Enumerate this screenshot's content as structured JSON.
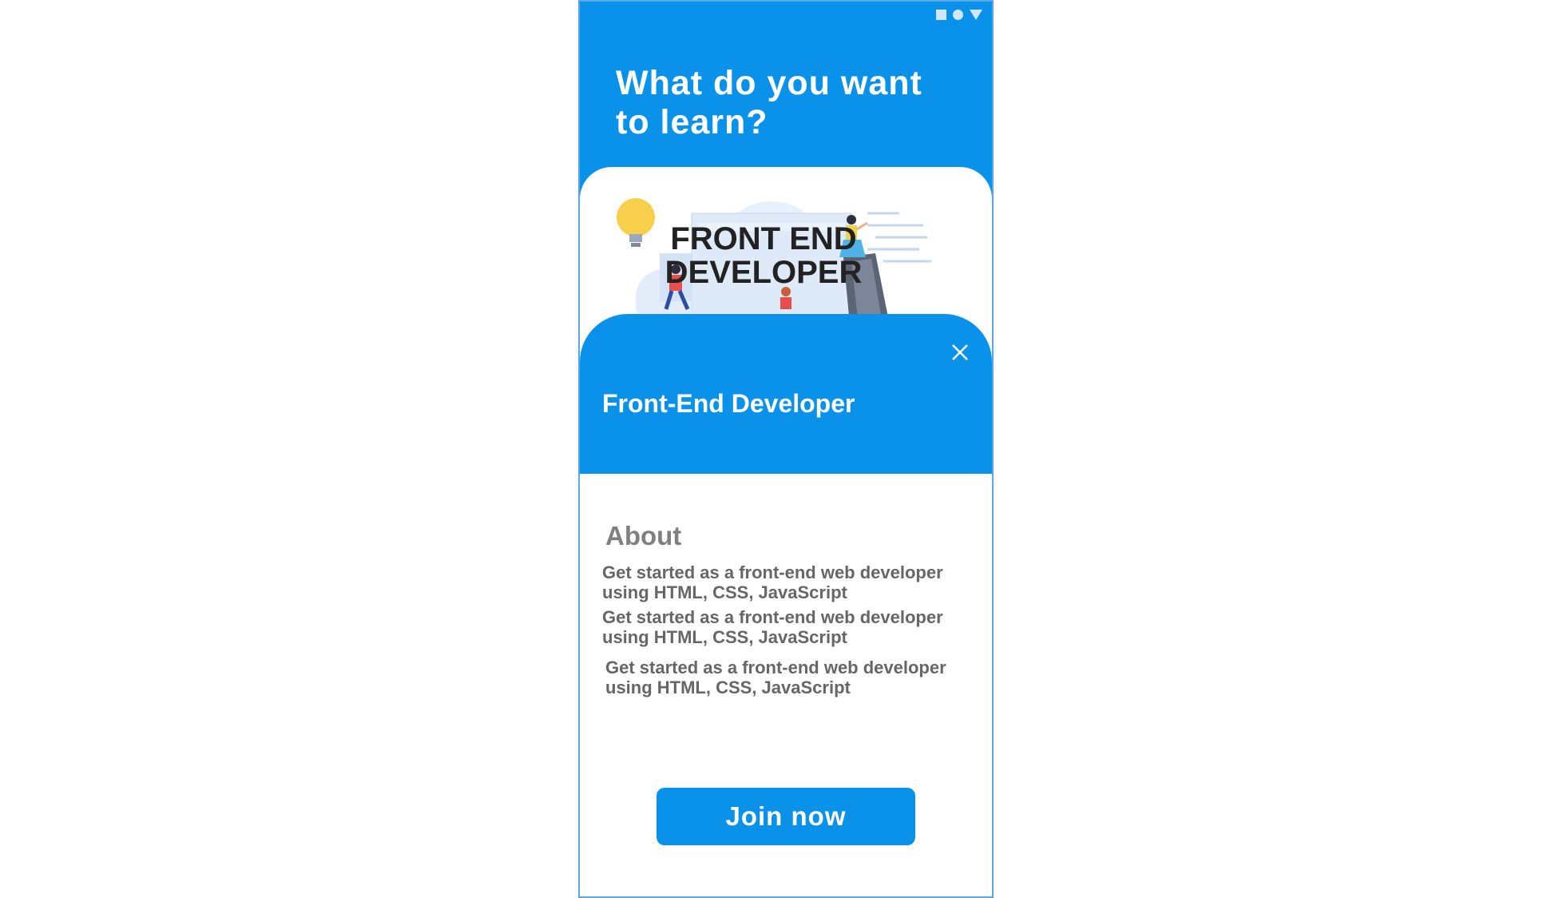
{
  "header": {
    "title_line1": "What do you want",
    "title_line2": "to learn?"
  },
  "card": {
    "illustration_line1": "FRONT END",
    "illustration_line2": "DEVELOPER"
  },
  "sheet": {
    "title": "Front-End Developer",
    "about_heading": "About",
    "descriptions": [
      "Get started as a front-end web developer using HTML, CSS, JavaScript",
      "Get started as a front-end web developer using HTML, CSS, JavaScript",
      "Get started as a front-end web developer using HTML, CSS, JavaScript"
    ],
    "join_label": "Join now"
  },
  "colors": {
    "primary": "#0a91ea",
    "text_gray": "#666666",
    "heading_gray": "#808080"
  },
  "icons": [
    "square-icon",
    "circle-icon",
    "triangle-icon",
    "close-icon",
    "lightbulb-icon"
  ]
}
